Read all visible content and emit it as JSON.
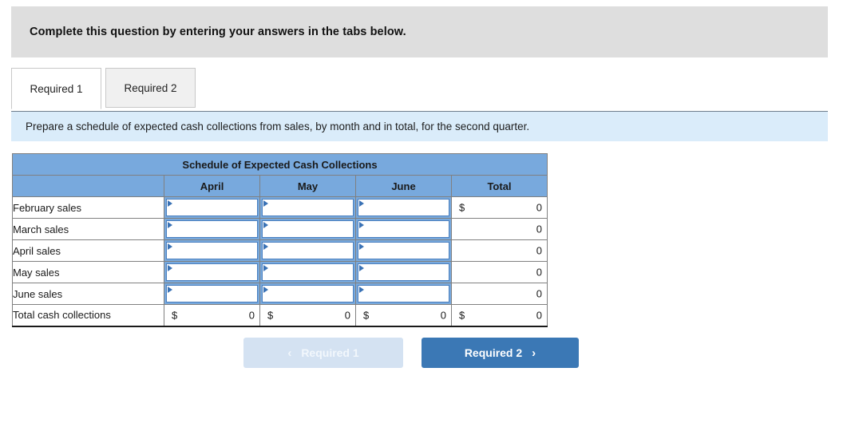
{
  "banner": {
    "text": "Complete this question by entering your answers in the tabs below."
  },
  "tabs": [
    {
      "label": "Required 1",
      "active": true
    },
    {
      "label": "Required 2",
      "active": false
    }
  ],
  "instruction": {
    "text": "Prepare a schedule of expected cash collections from sales, by month and in total, for the second quarter."
  },
  "table": {
    "title": "Schedule of Expected Cash Collections",
    "columns": [
      "April",
      "May",
      "June",
      "Total"
    ],
    "rows": [
      {
        "label": "February sales",
        "inputs": [
          "",
          "",
          ""
        ],
        "total_currency": "$",
        "total_value": "0"
      },
      {
        "label": "March sales",
        "inputs": [
          "",
          "",
          ""
        ],
        "total_currency": "",
        "total_value": "0"
      },
      {
        "label": "April sales",
        "inputs": [
          "",
          "",
          ""
        ],
        "total_currency": "",
        "total_value": "0"
      },
      {
        "label": "May sales",
        "inputs": [
          "",
          "",
          ""
        ],
        "total_currency": "",
        "total_value": "0"
      },
      {
        "label": "June sales",
        "inputs": [
          "",
          "",
          ""
        ],
        "total_currency": "",
        "total_value": "0"
      }
    ],
    "total_row": {
      "label": "Total cash collections",
      "cells": [
        {
          "currency": "$",
          "value": "0"
        },
        {
          "currency": "$",
          "value": "0"
        },
        {
          "currency": "$",
          "value": "0"
        },
        {
          "currency": "$",
          "value": "0"
        }
      ]
    }
  },
  "nav": {
    "prev_label": "Required 1",
    "prev_icon": "chevron-left-icon",
    "next_label": "Required 2",
    "next_icon": "chevron-right-icon",
    "prev_chevron": "‹",
    "next_chevron": "›"
  },
  "colors": {
    "banner_bg": "#dedede",
    "instruction_bg": "#daecfa",
    "header_blue": "#78a9dd",
    "button_active": "#3b78b5",
    "button_disabled": "#d4e2f2"
  }
}
